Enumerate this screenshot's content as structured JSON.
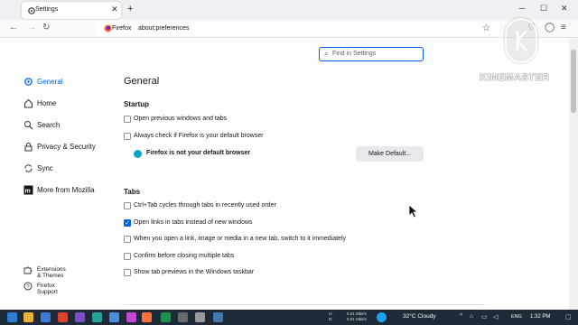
{
  "tab": {
    "title": "Settings"
  },
  "urlbar": {
    "identity": "Firefox",
    "url": "about:preferences"
  },
  "search": {
    "placeholder": "Find in Settings"
  },
  "sidebar": {
    "items": [
      {
        "label": "General"
      },
      {
        "label": "Home"
      },
      {
        "label": "Search"
      },
      {
        "label": "Privacy & Security"
      },
      {
        "label": "Sync"
      },
      {
        "label": "More from Mozilla"
      }
    ],
    "footer": [
      {
        "label": "Extensions & Themes"
      },
      {
        "label": "Firefox Support"
      }
    ]
  },
  "main": {
    "title": "General",
    "startup": {
      "heading": "Startup",
      "restore_previous": "Open previous windows and tabs",
      "check_default": "Always check if Firefox is your default browser",
      "not_default": "Firefox is not your default browser",
      "make_default_button": "Make Default..."
    },
    "tabs": {
      "heading": "Tabs",
      "options": [
        {
          "label": "Ctrl+Tab cycles through tabs in recently used order",
          "checked": false
        },
        {
          "label": "Open links in tabs instead of new windows",
          "checked": true
        },
        {
          "label": "When you open a link, image or media in a new tab, switch to it immediately",
          "checked": false
        },
        {
          "label": "Confirm before closing multiple tabs",
          "checked": false
        },
        {
          "label": "Show tab previews in the Windows taskbar",
          "checked": false
        }
      ]
    }
  },
  "watermark": {
    "text": "KINEMASTER"
  },
  "taskbar": {
    "net_up": "0.01 Mbit/s",
    "net_down": "0.01 Mbit/s",
    "net_up_label": "U:",
    "net_down_label": "D:",
    "weather": "32°C  Cloudy",
    "language": "ENG",
    "time": "1:32 PM"
  },
  "colors": {
    "accent": "#0061e0",
    "taskbar": "#1f2a38",
    "info_icon": "#0aa3c2"
  }
}
